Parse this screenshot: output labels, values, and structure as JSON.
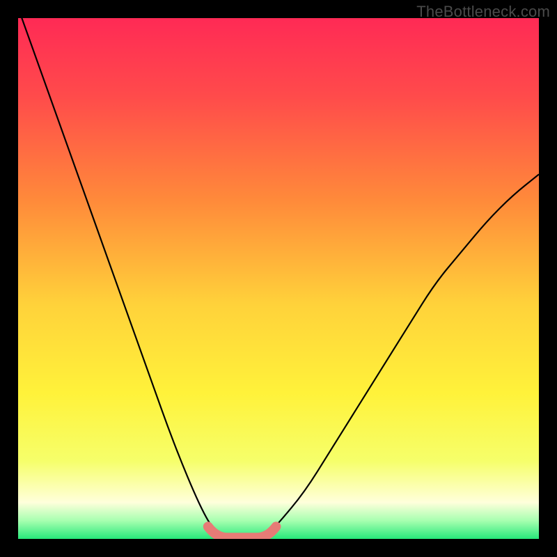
{
  "watermark": "TheBottleneck.com",
  "chart_data": {
    "type": "line",
    "title": "",
    "xlabel": "",
    "ylabel": "",
    "xlim": [
      0,
      1
    ],
    "ylim": [
      0,
      1
    ],
    "x": [
      0.0,
      0.05,
      0.1,
      0.15,
      0.2,
      0.25,
      0.3,
      0.35,
      0.38,
      0.4,
      0.42,
      0.44,
      0.46,
      0.48,
      0.5,
      0.55,
      0.6,
      0.65,
      0.7,
      0.75,
      0.8,
      0.85,
      0.9,
      0.95,
      1.0
    ],
    "values": [
      1.02,
      0.88,
      0.74,
      0.6,
      0.46,
      0.32,
      0.18,
      0.06,
      0.01,
      0.0,
      0.0,
      0.0,
      0.0,
      0.01,
      0.03,
      0.09,
      0.17,
      0.25,
      0.33,
      0.41,
      0.49,
      0.55,
      0.61,
      0.66,
      0.7
    ],
    "highlight_band": {
      "x_start": 0.37,
      "x_end": 0.49,
      "y": 0.005,
      "color": "#e77b76"
    },
    "gradient_stops": [
      {
        "pos": 0.0,
        "color": "#ff2a55"
      },
      {
        "pos": 0.15,
        "color": "#ff4b4b"
      },
      {
        "pos": 0.35,
        "color": "#ff8a3a"
      },
      {
        "pos": 0.55,
        "color": "#ffd23a"
      },
      {
        "pos": 0.72,
        "color": "#fff23a"
      },
      {
        "pos": 0.85,
        "color": "#f6ff6a"
      },
      {
        "pos": 0.93,
        "color": "#ffffdb"
      },
      {
        "pos": 0.965,
        "color": "#a7ffb0"
      },
      {
        "pos": 1.0,
        "color": "#27e87a"
      }
    ]
  }
}
